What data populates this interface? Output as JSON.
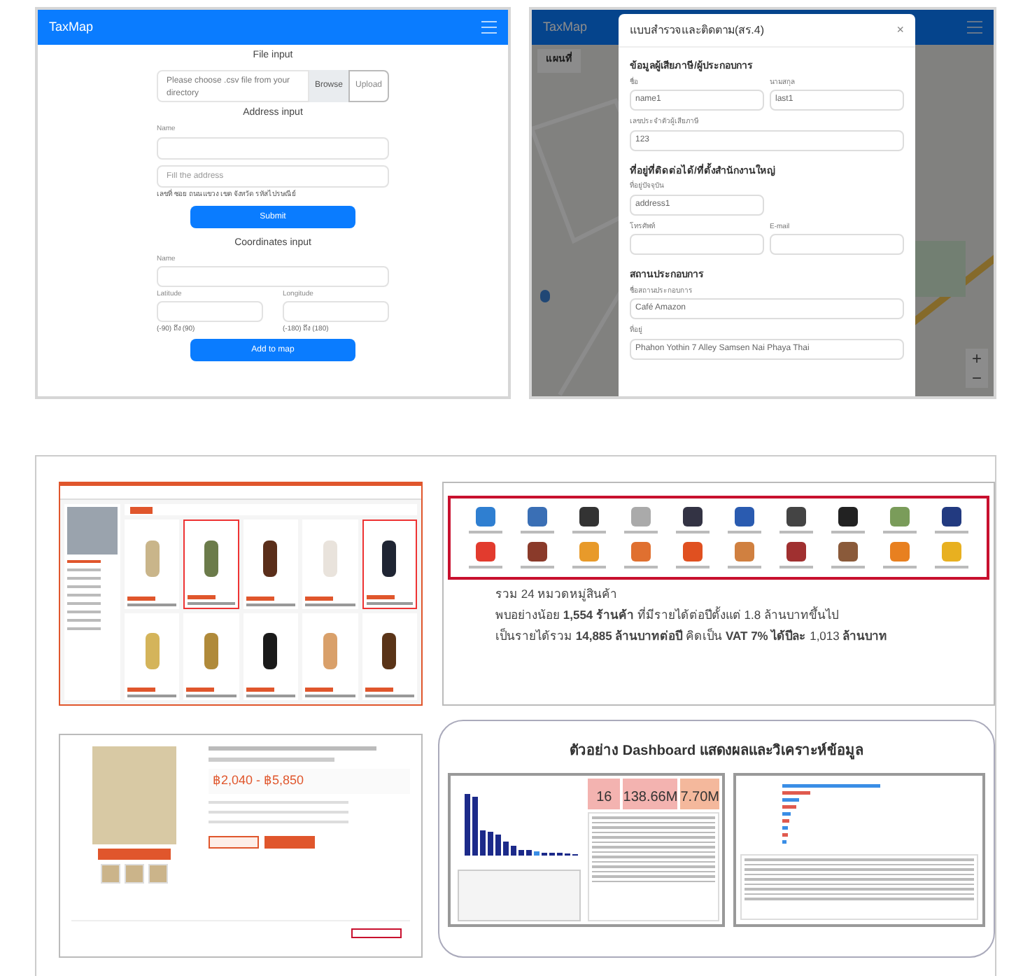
{
  "address_form_screen": {
    "app_title": "TaxMap",
    "file_input": {
      "heading": "File input",
      "placeholder": "Please choose .csv file from your directory",
      "browse": "Browse",
      "upload": "Upload"
    },
    "address_input": {
      "heading": "Address input",
      "name_label": "Name",
      "address_placeholder": "Fill the address",
      "hint": "เลขที่ ซอย ถนน แขวง เขต จังหวัด รหัสไปรษณีย์",
      "submit": "Submit"
    },
    "coordinates_input": {
      "heading": "Coordinates input",
      "name_label": "Name",
      "latitude_label": "Latitude",
      "longitude_label": "Longitude",
      "latitude_hint": "(-90) ถึง (90)",
      "longitude_hint": "(-180) ถึง (180)",
      "button": "Add to map"
    }
  },
  "survey_modal_screen": {
    "app_title": "TaxMap",
    "map_tabs": [
      "แผนที่"
    ],
    "zoom_in": "+",
    "zoom_out": "−",
    "modal": {
      "title": "แบบสำรวจและติดตาม(สร.4)",
      "close": "×",
      "sections": [
        {
          "heading": "ข้อมูลผู้เสียภาษี/ผู้ประกอบการ",
          "rows": [
            [
              {
                "label": "ชื่อ",
                "value": "name1"
              },
              {
                "label": "นามสกุล",
                "value": "last1"
              }
            ],
            [
              {
                "label": "เลขประจำตัวผู้เสียภาษี",
                "value": "123"
              }
            ]
          ]
        },
        {
          "heading": "ที่อยู่ที่ติดต่อได้/ที่ตั้งสำนักงานใหญ่",
          "rows": [
            [
              {
                "label": "ที่อยู่ปัจจุบัน",
                "value": "address1"
              }
            ],
            [
              {
                "label": "โทรศัพท์"
              },
              {
                "label": "E-mail"
              }
            ]
          ]
        },
        {
          "heading": "สถานประกอบการ",
          "rows": [
            [
              {
                "label": "ชื่อสถานประกอบการ",
                "value": "Café Amazon"
              }
            ],
            [
              {
                "label": "ที่อยู่",
                "value": "Phahon Yothin 7 Alley Samsen Nai Phaya Thai"
              }
            ]
          ]
        }
      ]
    }
  },
  "categories_panel": {
    "summary": [
      "รวม 24 หมวดหมู่สินค้า",
      "พบอย่างน้อย **1,554 ร้านค้า** ที่มีรายได้ต่อปีตั้งแต่ 1.8 ล้านบาทขึ้นไป",
      "เป็นรายได้รวม **14,885 ล้านบาทต่อปี** คิดเป็น **VAT 7% ได้ปีละ** 1,013 **ล้านบาท**"
    ]
  },
  "product_page": {
    "price": "฿2,040 - ฿5,850"
  },
  "dashboard_panel": {
    "title": "ตัวอย่าง Dashboard แสดงผลและวิเคราะห์ข้อมูล",
    "kpis": [
      "16",
      "138.66M",
      "7.70M"
    ]
  }
}
